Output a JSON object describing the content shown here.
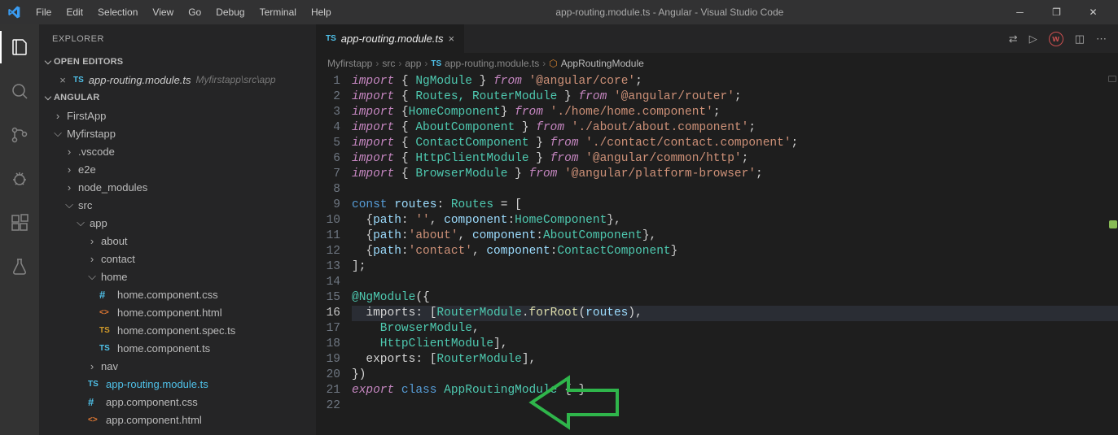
{
  "titlebar": {
    "menu": [
      "File",
      "Edit",
      "Selection",
      "View",
      "Go",
      "Debug",
      "Terminal",
      "Help"
    ],
    "title": "app-routing.module.ts - Angular - Visual Studio Code"
  },
  "sidebar": {
    "header": "EXPLORER",
    "openEditors": {
      "label": "OPEN EDITORS",
      "icon": "TS",
      "file": "app-routing.module.ts",
      "dir": "Myfirstapp\\src\\app"
    },
    "workspace": "ANGULAR",
    "tree": {
      "firstApp": "FirstApp",
      "myfirstapp": "Myfirstapp",
      "vscode": ".vscode",
      "e2e": "e2e",
      "node_modules": "node_modules",
      "src": "src",
      "app": "app",
      "about": "about",
      "contact": "contact",
      "home": "home",
      "homecss": "home.component.css",
      "homehtml": "home.component.html",
      "homespec": "home.component.spec.ts",
      "homets": "home.component.ts",
      "nav": "nav",
      "routing": "app-routing.module.ts",
      "appcss": "app.component.css",
      "apphtml": "app.component.html"
    }
  },
  "tab": {
    "icon": "TS",
    "label": "app-routing.module.ts"
  },
  "breadcrumb": {
    "p1": "Myfirstapp",
    "p2": "src",
    "p3": "app",
    "fileIcon": "TS",
    "file": "app-routing.module.ts",
    "symbol": "AppRoutingModule"
  },
  "code": {
    "l1_a": "import",
    "l1_b": " { ",
    "l1_c": "NgModule",
    "l1_d": " } ",
    "l1_e": "from",
    "l1_f": " '@angular/core'",
    "l1_g": ";",
    "l2_a": "import",
    "l2_b": " { ",
    "l2_c": "Routes, RouterModule",
    "l2_d": " } ",
    "l2_e": "from",
    "l2_f": " '@angular/router'",
    "l2_g": ";",
    "l3_a": "import",
    "l3_b": " {",
    "l3_c": "HomeComponent",
    "l3_d": "} ",
    "l3_e": "from",
    "l3_f": " './home/home.component'",
    "l3_g": ";",
    "l4_a": "import",
    "l4_b": " { ",
    "l4_c": "AboutComponent",
    "l4_d": " } ",
    "l4_e": "from",
    "l4_f": " './about/about.component'",
    "l4_g": ";",
    "l5_a": "import",
    "l5_b": " { ",
    "l5_c": "ContactComponent",
    "l5_d": " } ",
    "l5_e": "from",
    "l5_f": " './contact/contact.component'",
    "l5_g": ";",
    "l6_a": "import",
    "l6_b": " { ",
    "l6_c": "HttpClientModule",
    "l6_d": " } ",
    "l6_e": "from",
    "l6_f": " '@angular/common/http'",
    "l6_g": ";",
    "l7_a": "import",
    "l7_b": " { ",
    "l7_c": "BrowserModule",
    "l7_d": " } ",
    "l7_e": "from",
    "l7_f": " '@angular/platform-browser'",
    "l7_g": ";",
    "l9_a": "const ",
    "l9_b": "routes",
    "l9_c": ": ",
    "l9_d": "Routes",
    "l9_e": " = [",
    "l10": "  {path: '', component:HomeComponent},",
    "l11": "  {path:'about', component:AboutComponent},",
    "l12": "  {path:'contact', component:ContactComponent}",
    "l13": "];",
    "l15_a": "@",
    "l15_b": "NgModule",
    "l15_c": "({",
    "l16_a": "  imports: [",
    "l16_b": "RouterModule",
    "l16_c": ".",
    "l16_d": "forRoot",
    "l16_e": "(",
    "l16_f": "routes",
    "l16_g": "),",
    "l17": "    BrowserModule,",
    "l18": "    HttpClientModule],",
    "l19": "  exports: [RouterModule],",
    "l20": "})",
    "l21_a": "export",
    "l21_b": " class ",
    "l21_c": "AppRoutingModule",
    "l21_d": " { }"
  },
  "lineNumbers": [
    "1",
    "2",
    "3",
    "4",
    "5",
    "6",
    "7",
    "8",
    "9",
    "10",
    "11",
    "12",
    "13",
    "14",
    "15",
    "16",
    "17",
    "18",
    "19",
    "20",
    "21",
    "22"
  ],
  "currentLine": 16
}
